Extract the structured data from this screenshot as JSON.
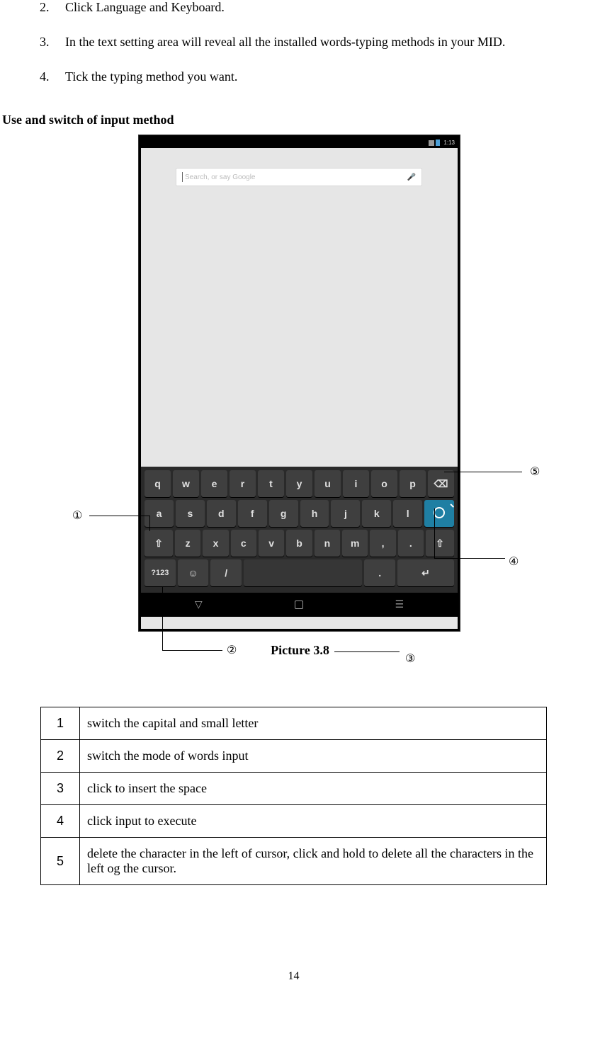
{
  "steps": [
    {
      "num": "2.",
      "text": "Click Language and Keyboard."
    },
    {
      "num": "3.",
      "text": "In the text setting area will reveal all the installed words-typing methods in your MID."
    },
    {
      "num": "4.",
      "text": "Tick the typing method you want."
    }
  ],
  "section_title": "Use and switch of input method",
  "device": {
    "status_time": "1:13",
    "search_placeholder": "Search, or say Google",
    "keyboard": {
      "row1": [
        "q",
        "w",
        "e",
        "r",
        "t",
        "y",
        "u",
        "i",
        "o",
        "p"
      ],
      "row2": [
        "a",
        "s",
        "d",
        "f",
        "g",
        "h",
        "j",
        "k",
        "l"
      ],
      "row3": [
        "z",
        "x",
        "c",
        "v",
        "b",
        "n",
        "m",
        ",",
        "."
      ],
      "mode_label": "?123",
      "slash": "/",
      "enter_glyph": "↵"
    }
  },
  "annotations": {
    "a1": "①",
    "a2": "②",
    "a3": "③",
    "a4": "④",
    "a5": "⑤"
  },
  "caption": "Picture 3.8",
  "legend": [
    {
      "n": "1",
      "d": "switch the capital and small letter"
    },
    {
      "n": "2",
      "d": "switch the mode of words input"
    },
    {
      "n": "3",
      "d": "click to insert the space"
    },
    {
      "n": "4",
      "d": "click input to execute"
    },
    {
      "n": "5",
      "d": "delete the character in the left of cursor, click and hold to delete all the characters in the left og the cursor."
    }
  ],
  "page_number": "14"
}
